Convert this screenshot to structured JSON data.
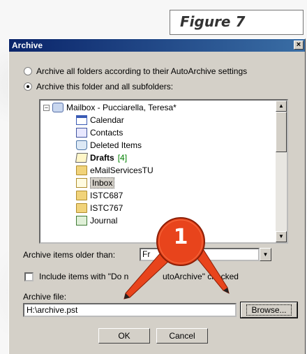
{
  "figure_label": "Figure 7",
  "dialog": {
    "title": "Archive",
    "close_symbol": "×",
    "option_all": "Archive all folders according to their AutoArchive settings",
    "option_this": "Archive this folder and all subfolders:",
    "selected_option": "option_this"
  },
  "tree": {
    "root": {
      "expander": "−",
      "label": "Mailbox - Pucciarella, Teresa*",
      "icon": "mailbox-icon"
    },
    "items": [
      {
        "label": "Calendar",
        "icon": "calendar-icon",
        "bold": false,
        "count": ""
      },
      {
        "label": "Contacts",
        "icon": "contacts-icon",
        "bold": false,
        "count": ""
      },
      {
        "label": "Deleted Items",
        "icon": "deleted-items-icon",
        "bold": false,
        "count": ""
      },
      {
        "label": "Drafts",
        "icon": "drafts-icon",
        "bold": true,
        "count": "[4]"
      },
      {
        "label": "eMailServicesTU",
        "icon": "folder-icon",
        "bold": false,
        "count": ""
      },
      {
        "label": "Inbox",
        "icon": "inbox-icon",
        "bold": false,
        "count": "",
        "selected": true
      },
      {
        "label": "ISTC687",
        "icon": "folder-icon",
        "bold": false,
        "count": ""
      },
      {
        "label": "ISTC767",
        "icon": "folder-icon",
        "bold": false,
        "count": ""
      },
      {
        "label": "Journal",
        "icon": "journal-icon",
        "bold": false,
        "count": ""
      }
    ],
    "scroll_up": "▲",
    "scroll_down": "▼"
  },
  "older_than": {
    "label": "Archive items older than:",
    "value": "Fr",
    "dropdown_symbol": "▼"
  },
  "include_checkbox": {
    "label_start": "Include items with \"Do n",
    "label_end": "utoArchive\" checked",
    "checked": false
  },
  "archive_file": {
    "label": "Archive file:",
    "value": "H:\\archive.pst",
    "browse_label": "Browse..."
  },
  "buttons": {
    "ok": "OK",
    "cancel": "Cancel"
  },
  "callout": {
    "number": "1",
    "color": "#e8441c"
  },
  "colors": {
    "titlebar_start": "#0a246a",
    "titlebar_end": "#3a6ea5",
    "dialog_face": "#d4d0c8"
  }
}
